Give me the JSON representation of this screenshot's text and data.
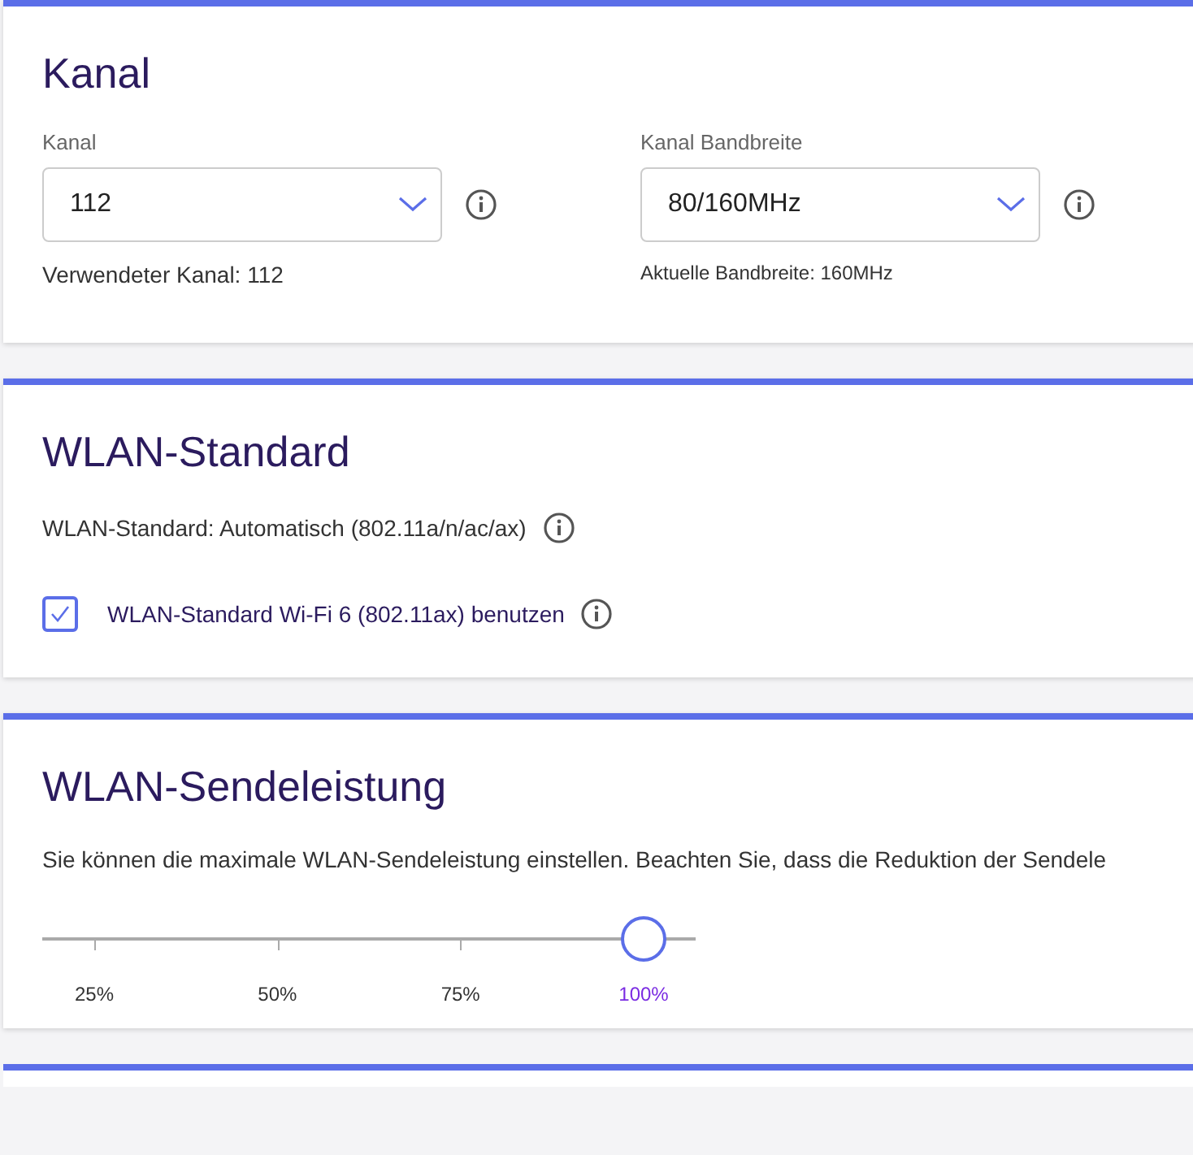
{
  "sections": [
    {
      "kind": "channel",
      "title": "Kanal",
      "selects": [
        {
          "label": "Kanal",
          "value": "112",
          "note": "Verwendeter Kanal: 112"
        },
        {
          "label": "Kanal Bandbreite",
          "value": "80/160MHz",
          "note": "Aktuelle Bandbreite: 160MHz"
        }
      ]
    },
    {
      "kind": "standard",
      "title": "WLAN-Standard",
      "status": "WLAN-Standard: Automatisch (802.11a/n/ac/ax)",
      "checkbox": {
        "label": "WLAN-Standard Wi-Fi 6 (802.11ax) benutzen",
        "checked": true
      }
    },
    {
      "kind": "power",
      "title": "WLAN-Sendeleistung",
      "description": "Sie können die maximale WLAN-Sendeleistung einstellen. Beachten Sie, dass die Reduktion der Sendele",
      "slider": {
        "level": 1,
        "stops": [
          {
            "label": "25%",
            "selected": false
          },
          {
            "label": "50%",
            "selected": false
          },
          {
            "label": "75%",
            "selected": false
          },
          {
            "label": "100%",
            "selected": true
          }
        ]
      }
    },
    {
      "kind": "empty"
    }
  ]
}
